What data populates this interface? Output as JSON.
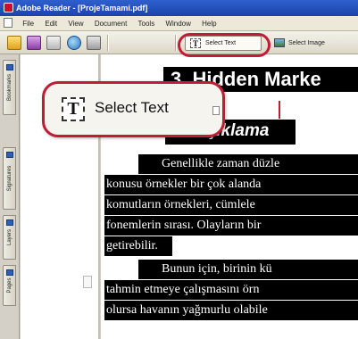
{
  "window": {
    "title": "Adobe Reader - [ProjeTamami.pdf]"
  },
  "menu": {
    "items": [
      "File",
      "Edit",
      "View",
      "Document",
      "Tools",
      "Window",
      "Help"
    ]
  },
  "toolbar": {
    "select_text_label": "Select Text",
    "select_image_label": "Select Image",
    "select_text_icon": "select-text-icon",
    "select_image_icon": "select-image-icon",
    "icons": [
      "open-folder-icon",
      "save-icon",
      "print-icon",
      "email-icon",
      "search-icon"
    ]
  },
  "sidebar": {
    "tabs": [
      "Bookmarks",
      "Signatures",
      "Layers",
      "Pages"
    ]
  },
  "callout": {
    "label": "Select Text",
    "accent": "#c01c36"
  },
  "document": {
    "heading": "3. Hidden Marke",
    "subheading": "2.1 Açıklama",
    "lines": [
      "Genellikle zaman düzle",
      "konusu örnekler bir çok alanda",
      "komutların örnekleri, cümlele",
      "fonemlerin sırası. Olayların bir",
      "getirebilir.",
      "Bunun için, birinin kü",
      "tahmin etmeye çalışmasını örn",
      "olursa havanın yağmurlu olabile"
    ]
  }
}
